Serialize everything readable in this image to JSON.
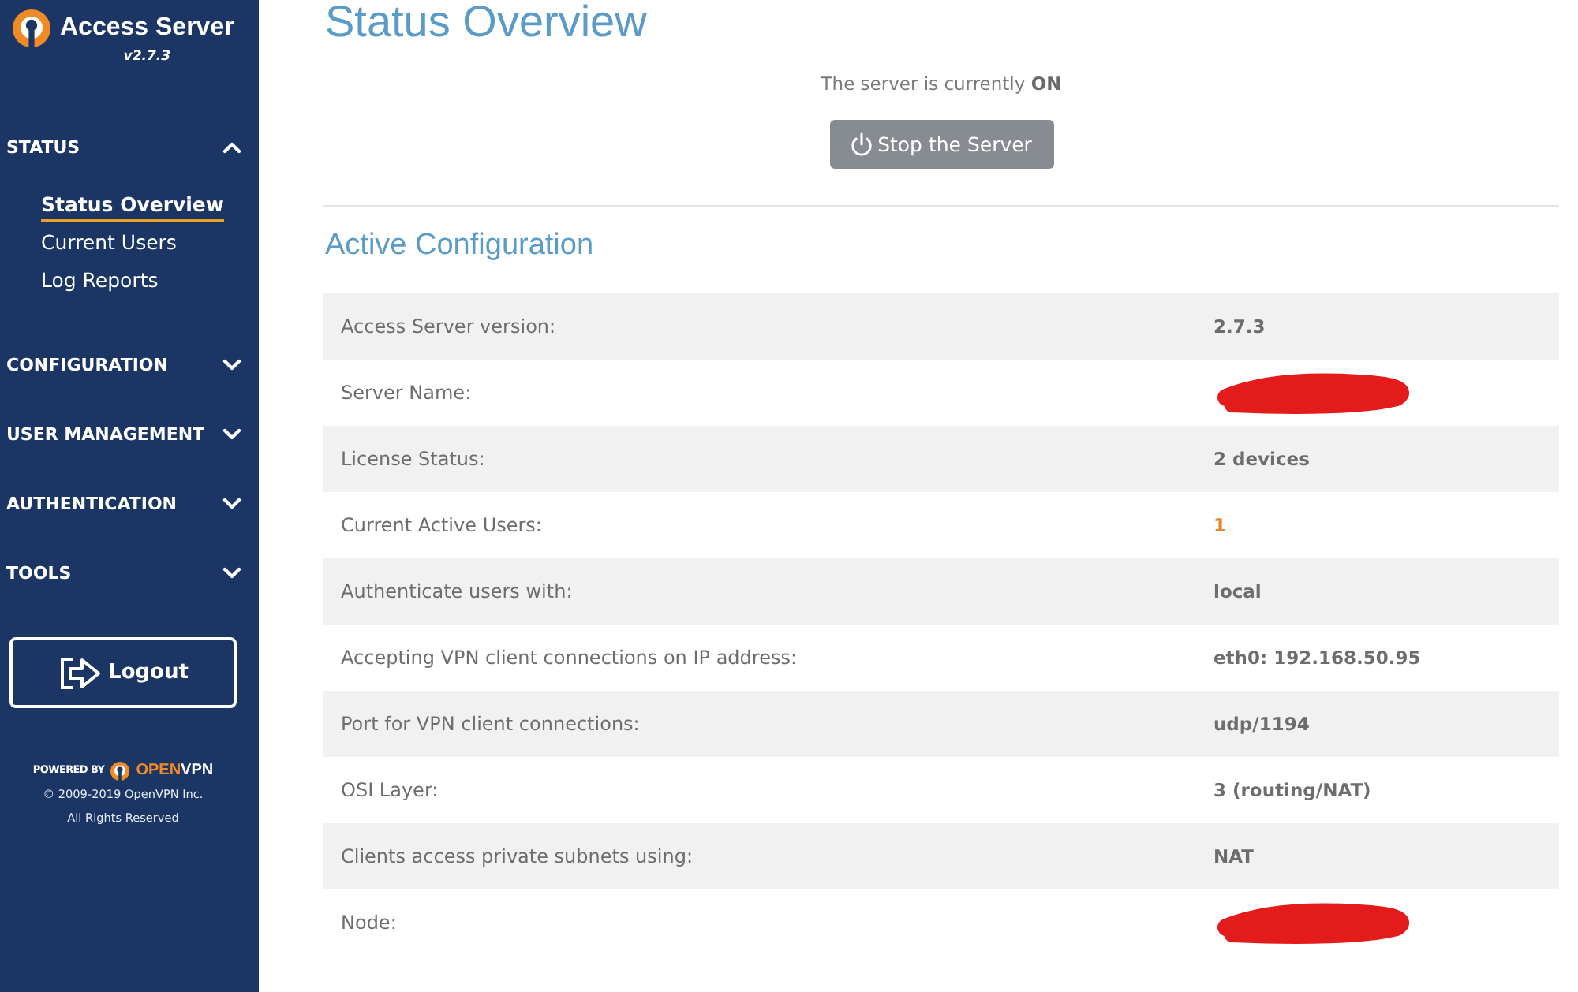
{
  "sidebar": {
    "logo": {
      "title": "Access Server",
      "version": "v2.7.3"
    },
    "sections": [
      {
        "label": "STATUS",
        "expanded": true,
        "items": [
          {
            "label": "Status Overview",
            "selected": true
          },
          {
            "label": "Current Users",
            "selected": false
          },
          {
            "label": "Log Reports",
            "selected": false
          }
        ]
      },
      {
        "label": "CONFIGURATION",
        "expanded": false
      },
      {
        "label": "USER MANAGEMENT",
        "expanded": false
      },
      {
        "label": "AUTHENTICATION",
        "expanded": false
      },
      {
        "label": "TOOLS",
        "expanded": false
      }
    ],
    "logout_button": "Logout",
    "footer": {
      "powered_by": "POWERED BY",
      "brand": [
        {
          "text": "OPEN",
          "color": "#f08a24"
        },
        {
          "text": "VPN",
          "color": "#ffffff"
        }
      ],
      "copyright": "© 2009-2019 OpenVPN Inc.",
      "rights": "All Rights Reserved"
    }
  },
  "page": {
    "title": "Status Overview",
    "status_text": "The server is currently **ON**",
    "stop_button": "Stop the Server"
  },
  "config": {
    "title": "Active Configuration",
    "rows": [
      {
        "label": "Access Server version:",
        "kind": "text",
        "value": "2.7.3"
      },
      {
        "label": "Server Name:",
        "kind": "redacted"
      },
      {
        "label": "License Status:",
        "kind": "text",
        "value": "2 devices"
      },
      {
        "label": "Current Active Users:",
        "kind": "link",
        "value": "1"
      },
      {
        "label": "Authenticate users with:",
        "kind": "text",
        "value": "local"
      },
      {
        "label": "Accepting VPN client connections on IP address:",
        "kind": "text",
        "value": "eth0: 192.168.50.95"
      },
      {
        "label": "Port for VPN client connections:",
        "kind": "text",
        "value": "udp/1194"
      },
      {
        "label": "OSI Layer:",
        "kind": "text",
        "value": "3 (routing/NAT)"
      },
      {
        "label": "Clients access private subnets using:",
        "kind": "text",
        "value": "NAT"
      },
      {
        "label": "Node:",
        "kind": "redacted"
      }
    ]
  }
}
